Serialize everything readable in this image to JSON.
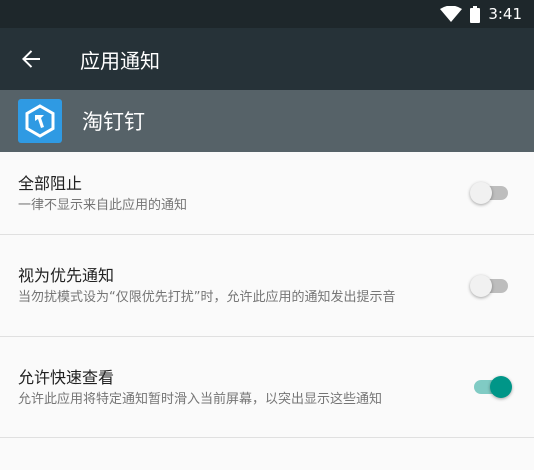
{
  "status_bar": {
    "time": "3:41",
    "icons": [
      "wifi-icon",
      "battery-icon"
    ]
  },
  "toolbar": {
    "title": "应用通知",
    "back_icon": "arrow-back-icon"
  },
  "app": {
    "name": "淘钉钉",
    "icon": "app-icon"
  },
  "settings": [
    {
      "label": "全部阻止",
      "summary": "一律不显示来自此应用的通知",
      "enabled": false
    },
    {
      "label": "视为优先通知",
      "summary": "当勿扰模式设为“仅限优先打扰”时，允许此应用的通知发出提示音",
      "enabled": false
    },
    {
      "label": "允许快速查看",
      "summary": "允许此应用将特定通知暂时滑入当前屏幕，以突出显示这些通知",
      "enabled": true
    }
  ],
  "colors": {
    "status_bar": "#1e272b",
    "toolbar": "#263238",
    "app_header": "#566268",
    "accent": "#009688"
  }
}
